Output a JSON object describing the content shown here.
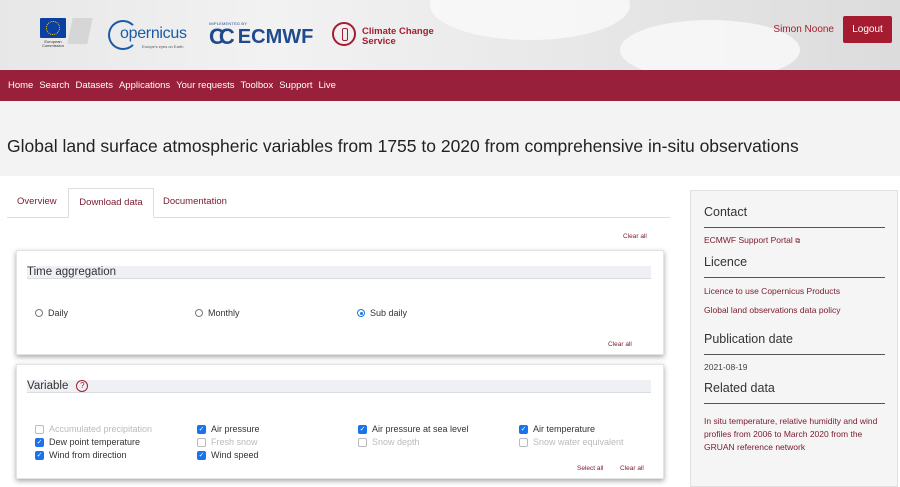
{
  "header": {
    "eu_logo_text": "European Commission",
    "copernicus": {
      "word": "opernicus",
      "tagline": "Europe's eyes on Earth"
    },
    "implemented_by": "IMPLEMENTED BY",
    "ecmwf": "ECMWF",
    "c3s": [
      "Climate Change",
      "Service"
    ],
    "user_name": "Simon Noone",
    "logout_label": "Logout"
  },
  "nav": [
    "Home",
    "Search",
    "Datasets",
    "Applications",
    "Your requests",
    "Toolbox",
    "Support",
    "Live"
  ],
  "page_title": "Global land surface atmospheric variables from 1755 to 2020 from comprehensive in-situ observations",
  "tabs": [
    "Overview",
    "Download data",
    "Documentation"
  ],
  "active_tab": "Download data",
  "clear_all_top": "Clear all",
  "time_aggregation": {
    "heading": "Time aggregation",
    "options": [
      {
        "label": "Daily",
        "selected": false
      },
      {
        "label": "Monthly",
        "selected": false
      },
      {
        "label": "Sub daily",
        "selected": true
      }
    ],
    "clear_all": "Clear all"
  },
  "variable": {
    "heading": "Variable",
    "help_icon": "?",
    "options": [
      {
        "label": "Accumulated precipitation",
        "checked": false,
        "disabled": true
      },
      {
        "label": "Air pressure",
        "checked": true,
        "disabled": false
      },
      {
        "label": "Air pressure at sea level",
        "checked": true,
        "disabled": false
      },
      {
        "label": "Air temperature",
        "checked": true,
        "disabled": false
      },
      {
        "label": "Dew point temperature",
        "checked": true,
        "disabled": false
      },
      {
        "label": "Fresh snow",
        "checked": false,
        "disabled": true
      },
      {
        "label": "Snow depth",
        "checked": false,
        "disabled": true
      },
      {
        "label": "Snow water equivalent",
        "checked": false,
        "disabled": true
      },
      {
        "label": "Wind from direction",
        "checked": true,
        "disabled": false
      },
      {
        "label": "Wind speed",
        "checked": true,
        "disabled": false
      }
    ],
    "select_all": "Select all",
    "clear_all": "Clear all"
  },
  "sidebar": {
    "contact": {
      "heading": "Contact",
      "link": "ECMWF Support Portal"
    },
    "licence": {
      "heading": "Licence",
      "links": [
        "Licence to use Copernicus Products",
        "Global land observations data policy"
      ]
    },
    "publication": {
      "heading": "Publication date",
      "date": "2021-08-19"
    },
    "related": {
      "heading": "Related data",
      "link": "In situ temperature, relative humidity and wind profiles from 2006 to March 2020 from the GRUAN reference network"
    }
  },
  "colors": {
    "brand": "#98203a",
    "checkbox": "#1a73e8",
    "link": "#7a1a2d"
  }
}
